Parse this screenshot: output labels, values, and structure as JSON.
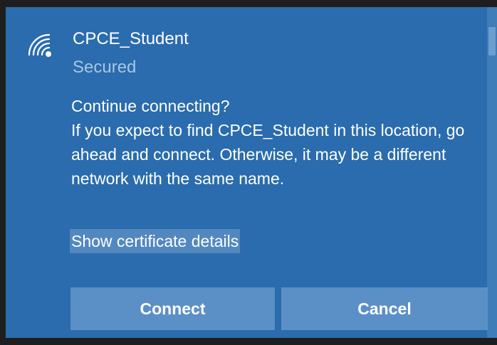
{
  "network": {
    "name": "CPCE_Student",
    "status": "Secured",
    "icon": "wifi-secured-icon"
  },
  "message": {
    "title": "Continue connecting?",
    "body": "If you expect to find CPCE_Student in this location, go ahead and connect. Otherwise, it may be a different network with the same name."
  },
  "certificate_link": "Show certificate details",
  "buttons": {
    "connect": "Connect",
    "cancel": "Cancel"
  },
  "colors": {
    "panel": "#2a6cad",
    "button": "#5b90c6",
    "link_highlight": "#5288bf",
    "secondary_text": "#a9c6e3"
  }
}
